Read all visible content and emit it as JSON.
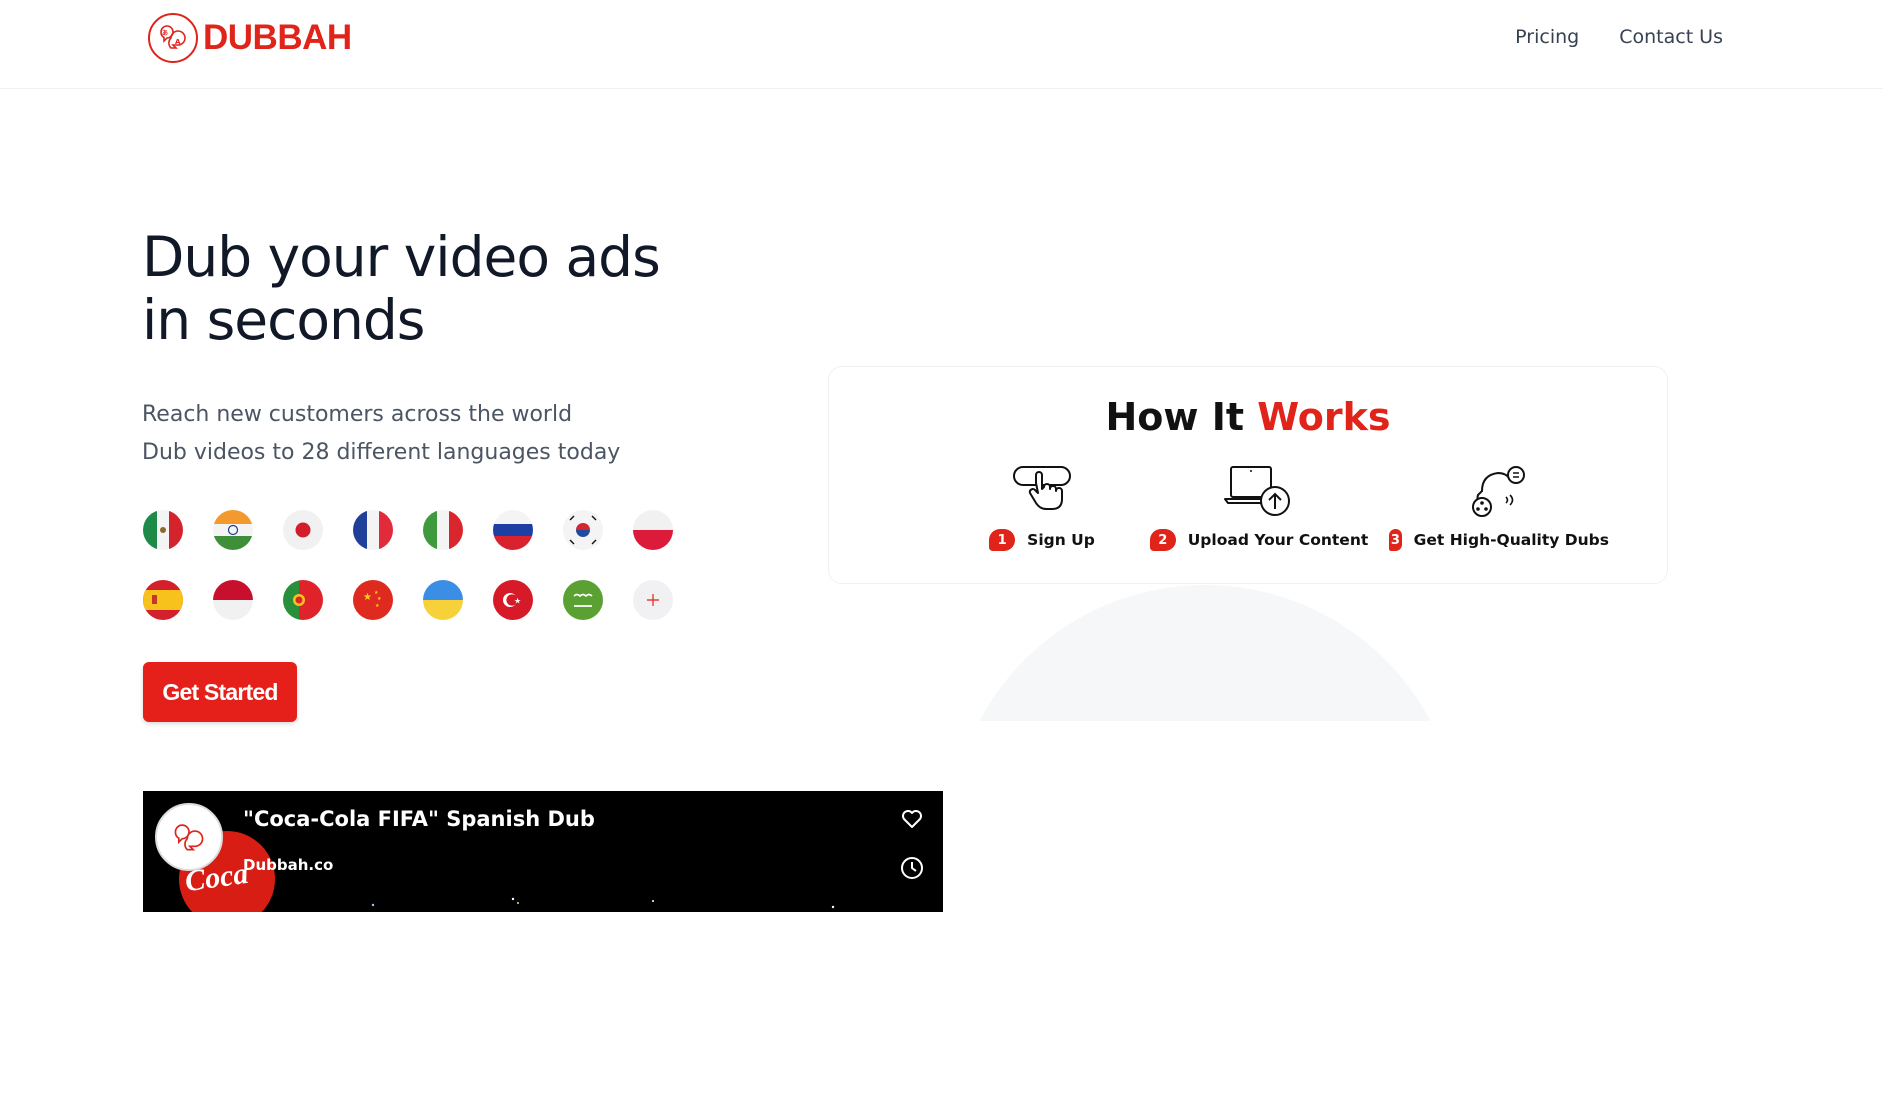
{
  "brand": {
    "name": "DUBBAH",
    "accent_color": "#e0241a",
    "logo_icon": "speech-bubbles-logo-icon"
  },
  "nav": {
    "items": [
      {
        "label": "Pricing"
      },
      {
        "label": "Contact Us"
      }
    ]
  },
  "hero": {
    "title_line1": "Dub your video ads",
    "title_line2": "in seconds",
    "subtitle_line1": "Reach new customers across the world",
    "subtitle_line2": "Dub videos to 28 different languages today",
    "cta_label": "Get Started",
    "flags": [
      "mexico-flag-icon",
      "india-flag-icon",
      "japan-flag-icon",
      "france-flag-icon",
      "italy-flag-icon",
      "russia-flag-icon",
      "south-korea-flag-icon",
      "poland-flag-icon",
      "spain-flag-icon",
      "indonesia-flag-icon",
      "portugal-flag-icon",
      "china-flag-icon",
      "ukraine-flag-icon",
      "turkey-flag-icon",
      "saudi-arabia-flag-icon",
      "plus-icon"
    ]
  },
  "how_it_works": {
    "title_part1": "How It ",
    "title_part2": "Works",
    "steps": [
      {
        "number": "1",
        "label": "Sign Up",
        "icon": "tap-button-icon"
      },
      {
        "number": "2",
        "label": "Upload Your Content",
        "icon": "laptop-upload-icon"
      },
      {
        "number": "3",
        "label": "Get High-Quality Dubs",
        "icon": "head-audio-icon"
      }
    ]
  },
  "video": {
    "title": "\"Coca-Cola FIFA\" Spanish Dub",
    "channel": "Dubbah.co",
    "icons": [
      "heart-icon",
      "clock-icon"
    ]
  }
}
